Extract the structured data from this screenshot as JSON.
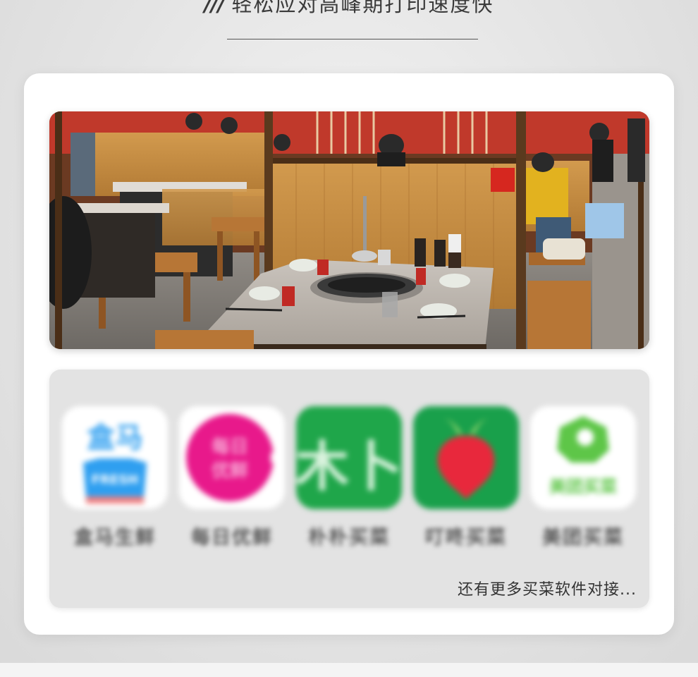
{
  "header": {
    "slashes": "///",
    "title": "轻松应对高峰期打印速度快"
  },
  "photo": {
    "description_icon": "restaurant-photo"
  },
  "apps_panel": {
    "apps": [
      {
        "name": "盒马生鲜",
        "icon": "hema-icon",
        "icon_text_top": "盒马",
        "icon_text_bottom": "FRESH"
      },
      {
        "name": "每日优鲜",
        "icon": "missfresh-icon",
        "icon_text_top": "每日",
        "icon_text_bottom": "优鲜"
      },
      {
        "name": "朴朴买菜",
        "icon": "pupu-icon",
        "icon_text_top": "木卜",
        "icon_text_bottom": ""
      },
      {
        "name": "叮咚买菜",
        "icon": "dingdong-icon",
        "icon_text_top": "",
        "icon_text_bottom": ""
      },
      {
        "name": "美团买菜",
        "icon": "meituan-icon",
        "icon_text_top": "",
        "icon_text_bottom": "美团买菜"
      }
    ],
    "more_text": "还有更多买菜软件对接..."
  },
  "colors": {
    "hema_blue": "#2f9ff0",
    "missfresh_pink": "#e8198b",
    "pupu_green": "#1fa64a",
    "dingdong_green": "#19a04b",
    "dingdong_red": "#e8283c",
    "meituan_green": "#5ec648"
  }
}
